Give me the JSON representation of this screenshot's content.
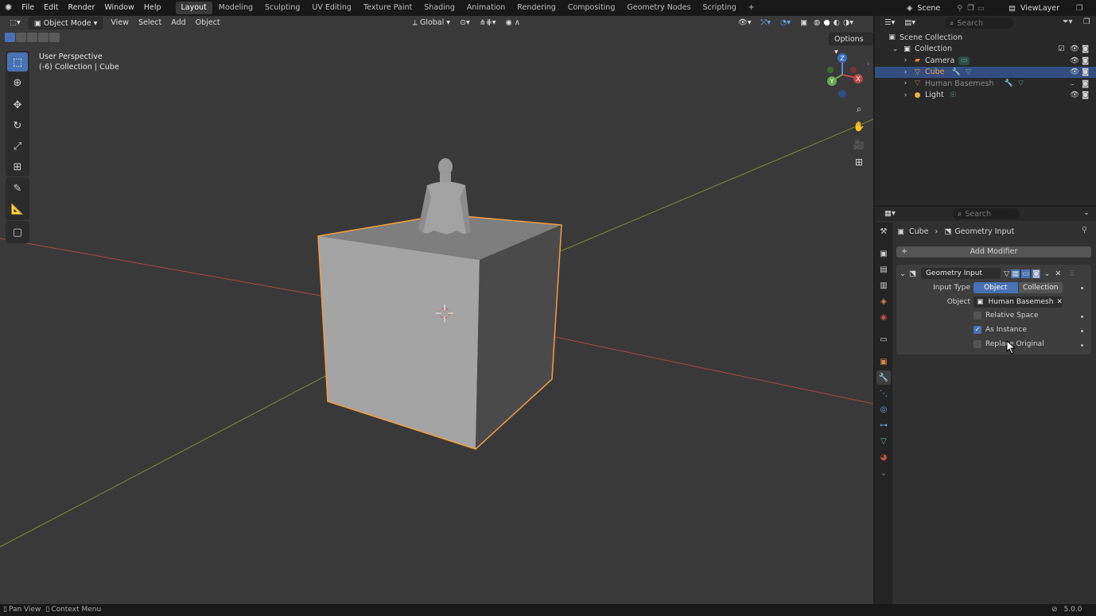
{
  "menus": [
    "File",
    "Edit",
    "Render",
    "Window",
    "Help"
  ],
  "workspaces": [
    "Layout",
    "Modeling",
    "Sculpting",
    "UV Editing",
    "Texture Paint",
    "Shading",
    "Animation",
    "Rendering",
    "Compositing",
    "Geometry Nodes",
    "Scripting",
    "+"
  ],
  "scene": {
    "label": "Scene",
    "view_layer": "ViewLayer"
  },
  "viewport": {
    "mode": "Object Mode",
    "menus": [
      "View",
      "Select",
      "Add",
      "Object"
    ],
    "transform_orientation": "Global",
    "options_label": "Options",
    "overlay_title": "User Perspective",
    "overlay_subtitle": "(-6) Collection | Cube",
    "gizmo_axes": {
      "z": "Z",
      "y": "Y",
      "x": "X"
    }
  },
  "outliner": {
    "search_placeholder": "Search",
    "root": "Scene Collection",
    "collection": "Collection",
    "items": [
      {
        "name": "Camera",
        "color": "#d0d0d0"
      },
      {
        "name": "Cube",
        "color": "#f0a040"
      },
      {
        "name": "Human Basemesh",
        "color": "#8a8a8a"
      },
      {
        "name": "Light",
        "color": "#d0d0d0"
      }
    ]
  },
  "properties": {
    "search_placeholder": "Search",
    "breadcrumb_object": "Cube",
    "breadcrumb_modifier": "Geometry Input",
    "add_modifier": "Add Modifier",
    "modifier_name": "Geometry Input",
    "input_type_label": "Input Type",
    "input_type_options": [
      "Object",
      "Collection"
    ],
    "object_label": "Object",
    "object_value": "Human Basemesh",
    "relative_space": "Relative Space",
    "as_instance": "As Instance",
    "replace_original": "Replace Original"
  },
  "status": {
    "pan": "Pan View",
    "context": "Context Menu",
    "version": "5.0.0"
  },
  "colors": {
    "accent": "#4772b3",
    "selected_outline": "#f0a040",
    "viewport_bg": "#393939"
  }
}
